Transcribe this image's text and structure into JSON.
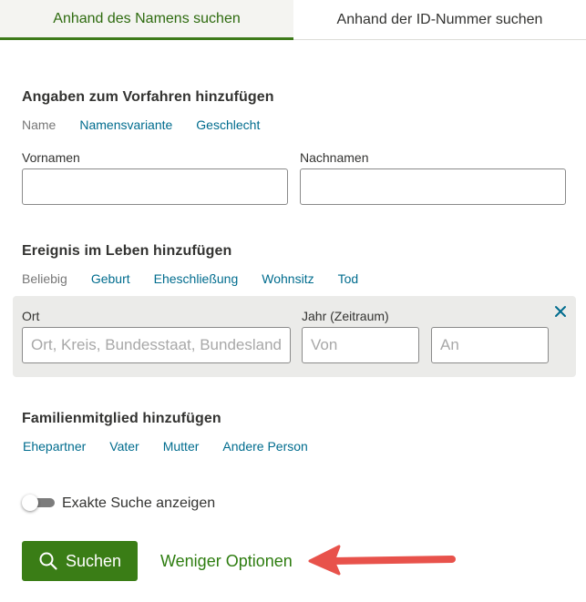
{
  "tabs": [
    {
      "label": "Anhand des Namens suchen",
      "active": true
    },
    {
      "label": "Anhand der ID-Nummer suchen",
      "active": false
    }
  ],
  "ancestor": {
    "heading": "Angaben zum Vorfahren hinzufügen",
    "subnav": {
      "current": "Name",
      "links": [
        "Namensvariante",
        "Geschlecht"
      ]
    },
    "first_name": {
      "label": "Vornamen",
      "value": "",
      "placeholder": ""
    },
    "last_name": {
      "label": "Nachnamen",
      "value": "",
      "placeholder": ""
    }
  },
  "event": {
    "heading": "Ereignis im Leben hinzufügen",
    "subnav": {
      "current": "Beliebig",
      "links": [
        "Geburt",
        "Eheschließung",
        "Wohnsitz",
        "Tod"
      ]
    },
    "place": {
      "label": "Ort",
      "value": "",
      "placeholder": "Ort, Kreis, Bundesstaat, Bundesland"
    },
    "year": {
      "label": "Jahr (Zeitraum)",
      "from_placeholder": "Von",
      "to_placeholder": "An"
    },
    "close_icon": "close-x-icon"
  },
  "family": {
    "heading": "Familienmitglied hinzufügen",
    "links": [
      "Ehepartner",
      "Vater",
      "Mutter",
      "Andere Person"
    ]
  },
  "exact_search": {
    "label": "Exakte Suche anzeigen",
    "enabled": false
  },
  "actions": {
    "search_label": "Suchen",
    "search_icon": "magnifier-icon",
    "fewer_options_label": "Weniger Optionen"
  },
  "annotation": {
    "arrow_icon": "red-arrow-left-icon",
    "color": "#e8524b"
  },
  "colors": {
    "brand_green": "#3a7d16",
    "link_blue": "#006c8e",
    "tab_active_text": "#2e6b0f"
  }
}
